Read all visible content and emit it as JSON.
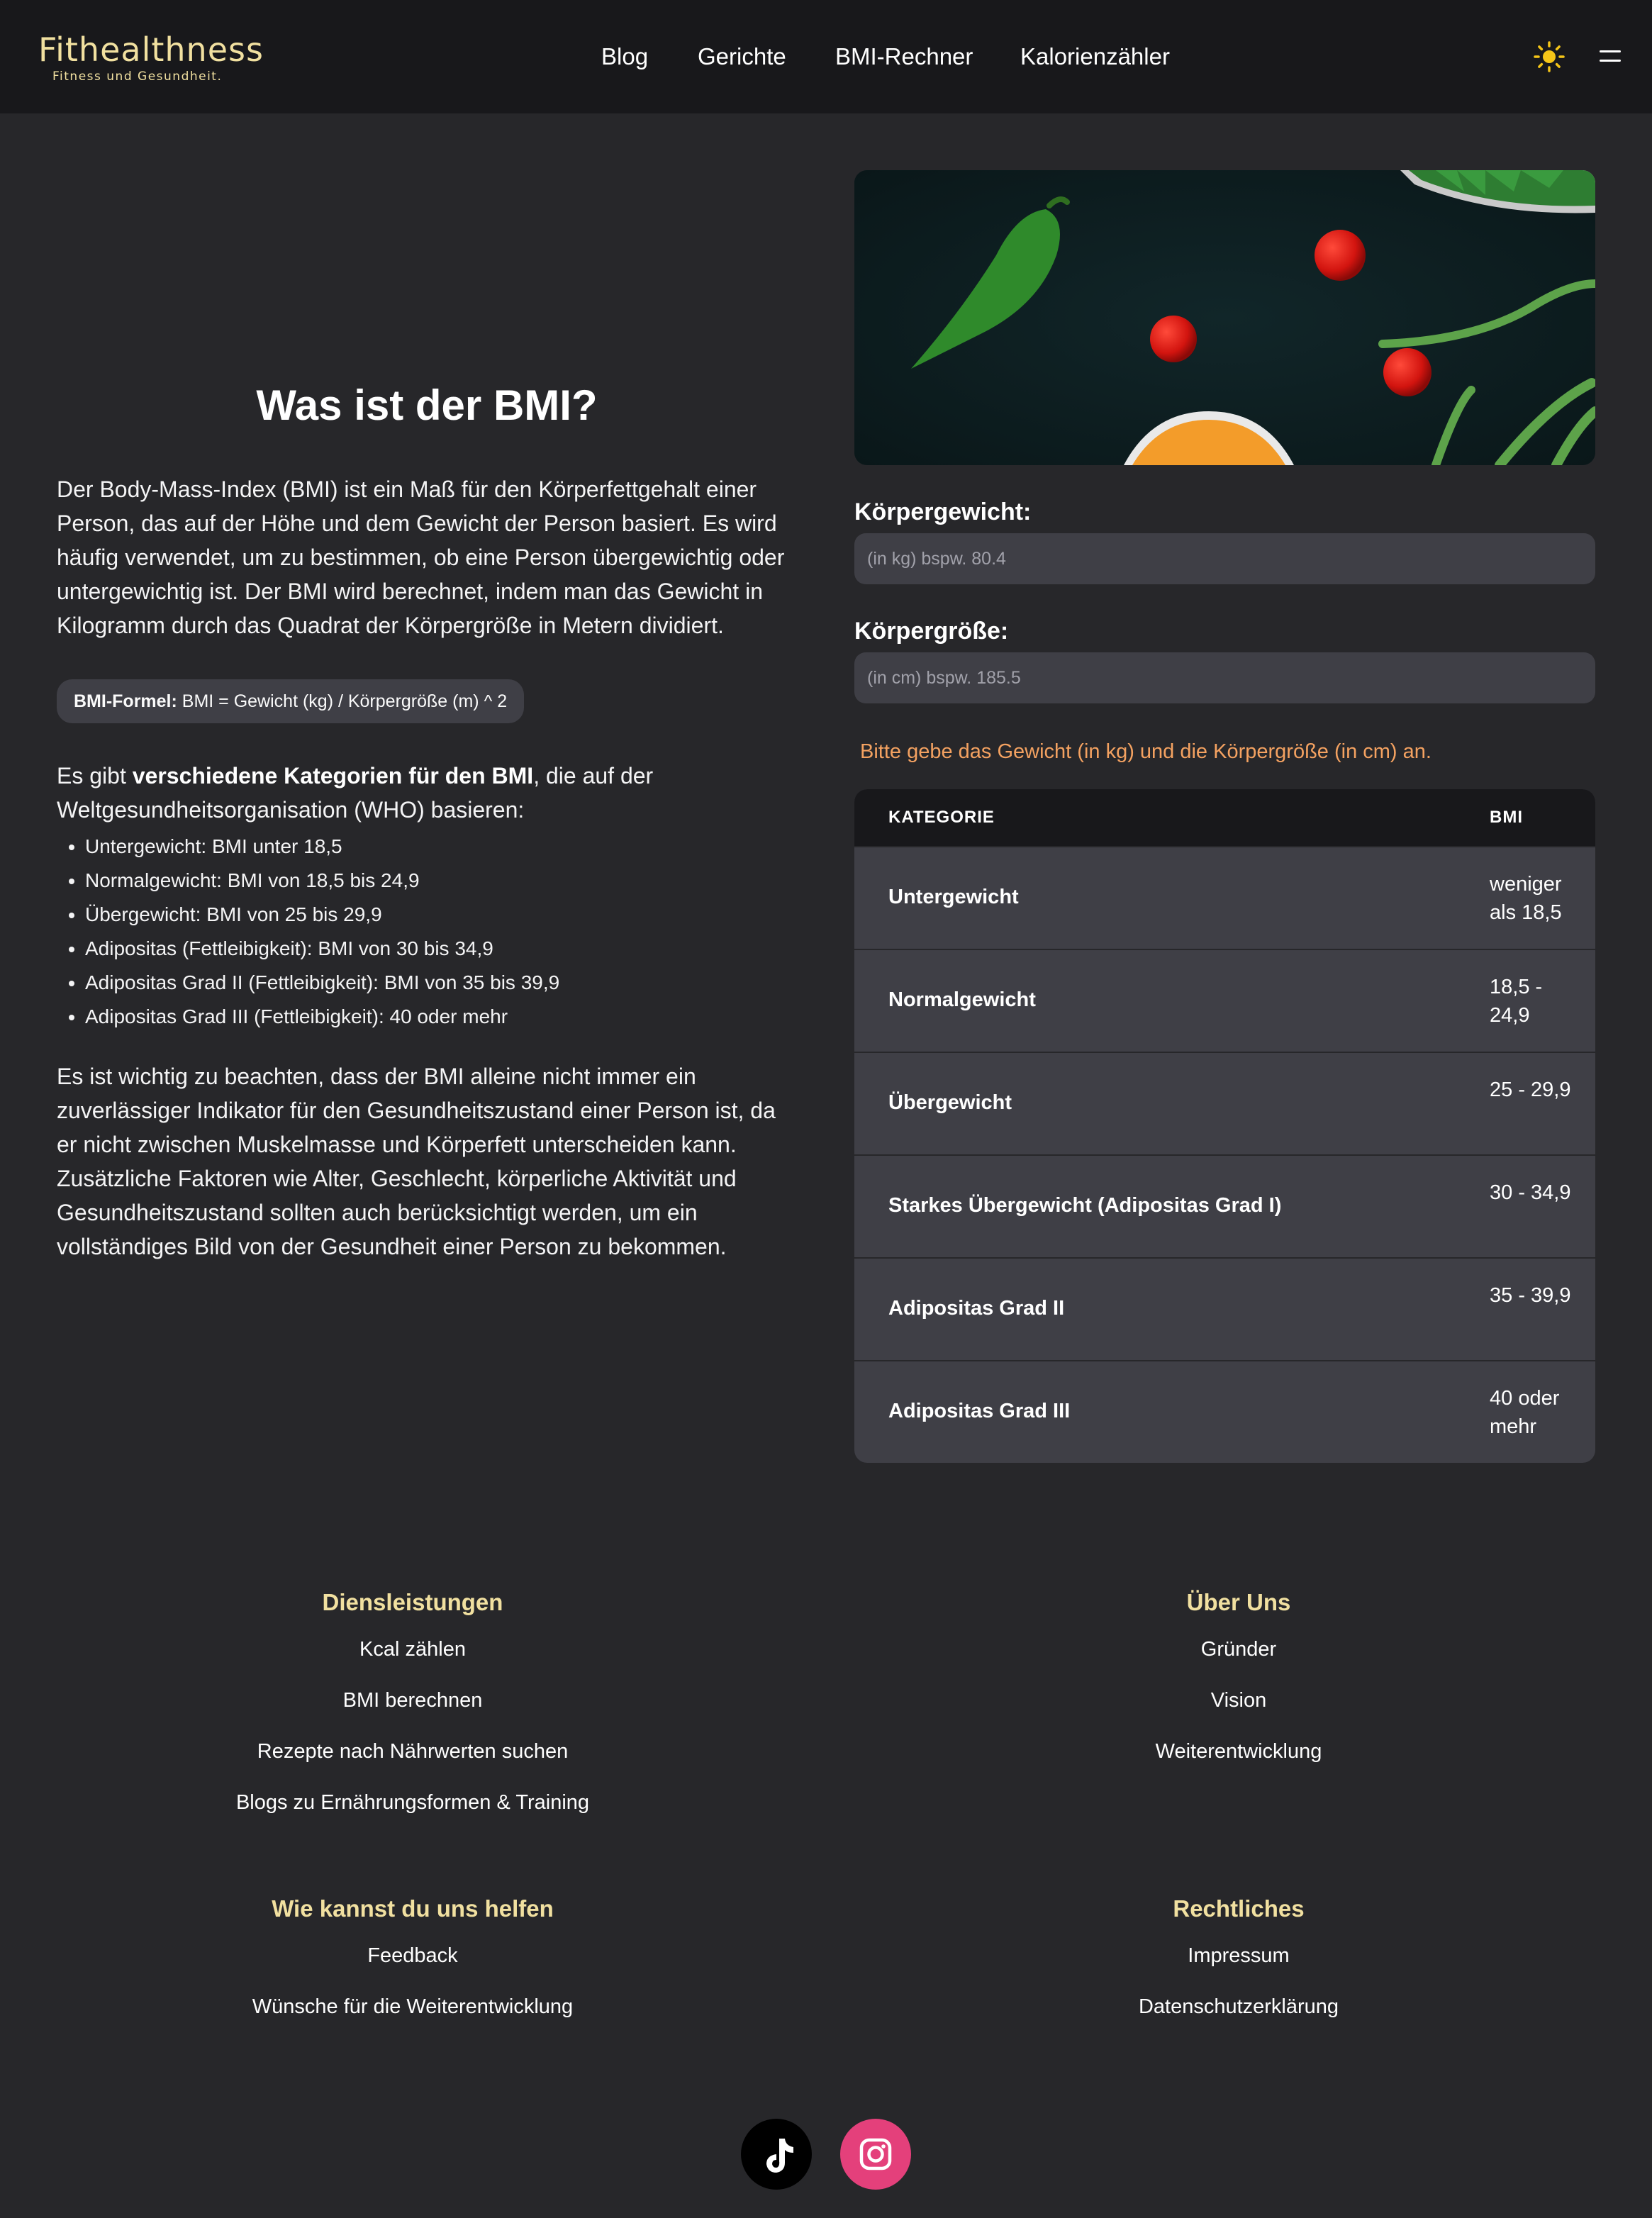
{
  "brand": {
    "name": "Fithealthness",
    "tagline": "Fitness und Gesundheit."
  },
  "nav": {
    "links": [
      "Blog",
      "Gerichte",
      "BMI-Rechner",
      "Kalorienzähler"
    ],
    "theme_icon": "sun-icon",
    "menu_icon": "hamburger-icon"
  },
  "info": {
    "title": "Was ist der BMI?",
    "intro": "Der Body-Mass-Index (BMI) ist ein Maß für den Körperfettgehalt einer Person, das auf der Höhe und dem Gewicht der Person basiert. Es wird häufig verwendet, um zu bestimmen, ob eine Person übergewichtig oder untergewichtig ist. Der BMI wird berechnet, indem man das Gewicht in Kilogramm durch das Quadrat der Körpergröße in Metern dividiert.",
    "formula_label": "BMI-Formel:",
    "formula_text": " BMI = Gewicht (kg) / Körpergröße (m) ^ 2",
    "categories_intro_pre": "Es gibt ",
    "categories_intro_bold": "verschiedene Kategorien für den BMI",
    "categories_intro_post": ", die auf der Weltgesundheitsorganisation (WHO) basieren:",
    "categories": [
      "Untergewicht: BMI unter 18,5",
      "Normalgewicht: BMI von 18,5 bis 24,9",
      "Übergewicht: BMI von 25 bis 29,9",
      "Adipositas (Fettleibigkeit): BMI von 30 bis 34,9",
      "Adipositas Grad II (Fettleibigkeit): BMI von 35 bis 39,9",
      "Adipositas Grad III (Fettleibigkeit): 40 oder mehr"
    ],
    "note": "Es ist wichtig zu beachten, dass der BMI alleine nicht immer ein zuverlässiger Indikator für den Gesundheitszustand einer Person ist, da er nicht zwischen Muskelmasse und Körperfett unterscheiden kann. Zusätzliche Faktoren wie Alter, Geschlecht, körperliche Aktivität und Gesundheitszustand sollten auch berücksichtigt werden, um ein vollständiges Bild von der Gesundheit einer Person zu bekommen."
  },
  "calculator": {
    "weight_label": "Körpergewicht:",
    "weight_placeholder": "(in kg) bspw. 80.4",
    "weight_value": "",
    "height_label": "Körpergröße:",
    "height_placeholder": "(in cm) bspw. 185.5",
    "height_value": "",
    "hint": "Bitte gebe das Gewicht (in kg) und die Körpergröße (in cm) an."
  },
  "table": {
    "headers": [
      "KATEGORIE",
      "BMI"
    ],
    "rows": [
      {
        "category": "Untergewicht",
        "bmi": "weniger als 18,5"
      },
      {
        "category": "Normalgewicht",
        "bmi": "18,5 - 24,9"
      },
      {
        "category": "Übergewicht",
        "bmi": "25 - 29,9"
      },
      {
        "category": "Starkes Übergewicht (Adipositas Grad I)",
        "bmi": "30 - 34,9"
      },
      {
        "category": "Adipositas Grad II",
        "bmi": "35 - 39,9"
      },
      {
        "category": "Adipositas Grad III",
        "bmi": "40 oder mehr"
      }
    ]
  },
  "footer": {
    "services": {
      "title": "Diensleistungen",
      "links": [
        "Kcal zählen",
        "BMI berechnen",
        "Rezepte nach Nährwerten suchen",
        "Blogs zu Ernährungsformen & Training"
      ]
    },
    "about": {
      "title": "Über Uns",
      "links": [
        "Gründer",
        "Vision",
        "Weiterentwicklung"
      ]
    },
    "help": {
      "title": "Wie kannst du uns helfen",
      "links": [
        "Feedback",
        "Wünsche für die Weiterentwicklung"
      ]
    },
    "legal": {
      "title": "Rechtliches",
      "links": [
        "Impressum",
        "Datenschutzerklärung"
      ]
    },
    "social": [
      "tiktok-icon",
      "instagram-icon"
    ]
  },
  "colors": {
    "background": "#27272a",
    "nav_background": "#18181b",
    "accent_gold": "#f1e0a0",
    "hint_orange": "#f4a261",
    "instagram_pink": "#e4407b"
  }
}
